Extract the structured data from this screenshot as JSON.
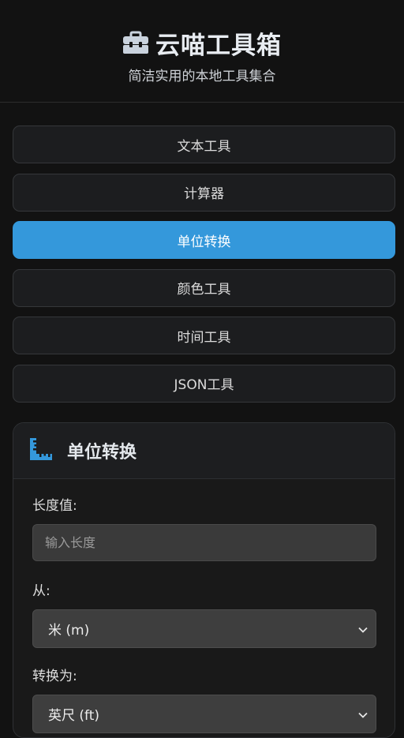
{
  "header": {
    "title": "云喵工具箱",
    "subtitle": "简洁实用的本地工具集合",
    "logo_icon": "toolbox-icon"
  },
  "nav": {
    "items": [
      {
        "label": "文本工具",
        "active": false
      },
      {
        "label": "计算器",
        "active": false
      },
      {
        "label": "单位转换",
        "active": true
      },
      {
        "label": "颜色工具",
        "active": false
      },
      {
        "label": "时间工具",
        "active": false
      },
      {
        "label": "JSON工具",
        "active": false
      }
    ]
  },
  "panel": {
    "title": "单位转换",
    "icon": "ruler-icon",
    "length_label": "长度值:",
    "length_placeholder": "输入长度",
    "length_value": "",
    "from_label": "从:",
    "from_value": "米 (m)",
    "to_label": "转换为:",
    "to_value": "英尺 (ft)"
  },
  "colors": {
    "accent": "#3498db",
    "background": "#121212",
    "icon": "#c9d2dd"
  }
}
